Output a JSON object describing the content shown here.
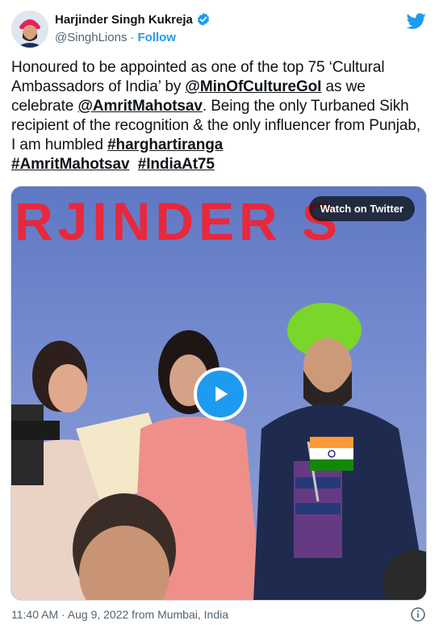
{
  "author": {
    "name": "Harjinder Singh Kukreja",
    "handle": "@SinghLions",
    "separator": "·",
    "follow_label": "Follow"
  },
  "tweet": {
    "t1": "Honoured to be appointed as one of the top 75 ‘Cultural Ambassadors of India’ by ",
    "mention1": "@MinOfCultureGoI",
    "t2": " as we celebrate ",
    "mention2": "@AmritMahotsav",
    "t3": ". Being the only Turbaned Sikh recipient of the recognition & the only influencer from Punjab, I am humbled ",
    "hashtag1": "#harghartiranga",
    "hashtag2": "#AmritMahotsav",
    "hashtag3": "#IndiaAt75"
  },
  "media": {
    "watch_label": "Watch on Twitter",
    "banner_text": "RJINDER S"
  },
  "footer": {
    "timestamp": "11:40 AM · Aug 9, 2022 from Mumbai, India"
  },
  "colors": {
    "accent": "#1d9bf0",
    "text": "#0f1419",
    "secondary": "#536471"
  },
  "icons": [
    "verified-badge-icon",
    "twitter-bird-icon",
    "play-icon",
    "info-icon"
  ]
}
